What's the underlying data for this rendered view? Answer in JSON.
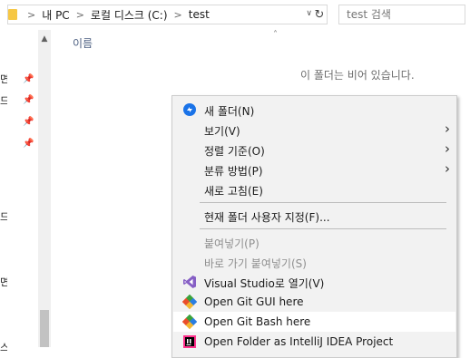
{
  "address_bar": {
    "breadcrumbs": [
      "내 PC",
      "로컬 디스크 (C:)",
      "test"
    ]
  },
  "search": {
    "placeholder": "test 검색"
  },
  "nav_pane": {
    "edge_labels": [
      "면",
      "드",
      "",
      "",
      "드",
      "면",
      "스크 (C:)"
    ]
  },
  "content": {
    "column_name": "이름",
    "empty_message": "이 폴더는 비어 있습니다."
  },
  "context_menu": {
    "items": [
      {
        "label": "새 폴더(N)",
        "icon": "new-folder-icon",
        "has_submenu": false,
        "disabled": false
      },
      {
        "label": "보기(V)",
        "icon": "",
        "has_submenu": true,
        "disabled": false
      },
      {
        "label": "정렬 기준(O)",
        "icon": "",
        "has_submenu": true,
        "disabled": false
      },
      {
        "label": "분류 방법(P)",
        "icon": "",
        "has_submenu": true,
        "disabled": false
      },
      {
        "label": "새로 고침(E)",
        "icon": "",
        "has_submenu": false,
        "disabled": false
      },
      {
        "label": "현재 폴더 사용자 지정(F)...",
        "icon": "",
        "has_submenu": false,
        "disabled": false
      },
      {
        "label": "붙여넣기(P)",
        "icon": "",
        "has_submenu": false,
        "disabled": true
      },
      {
        "label": "바로 가기 붙여넣기(S)",
        "icon": "",
        "has_submenu": false,
        "disabled": true
      },
      {
        "label": "Visual Studio로 열기(V)",
        "icon": "visual-studio-icon",
        "has_submenu": false,
        "disabled": false
      },
      {
        "label": "Open Git GUI here",
        "icon": "git-gui-icon",
        "has_submenu": false,
        "disabled": false
      },
      {
        "label": "Open Git Bash here",
        "icon": "git-bash-icon",
        "has_submenu": false,
        "disabled": false,
        "hovered": true
      },
      {
        "label": "Open Folder as IntelliJ IDEA Project",
        "icon": "intellij-icon",
        "has_submenu": false,
        "disabled": false
      }
    ]
  },
  "colors": {
    "menu_bg": "#f2f2f2",
    "hover_bg": "#ffffff",
    "column_header": "#4d6082",
    "new_folder_icon": "#1a73e8"
  }
}
